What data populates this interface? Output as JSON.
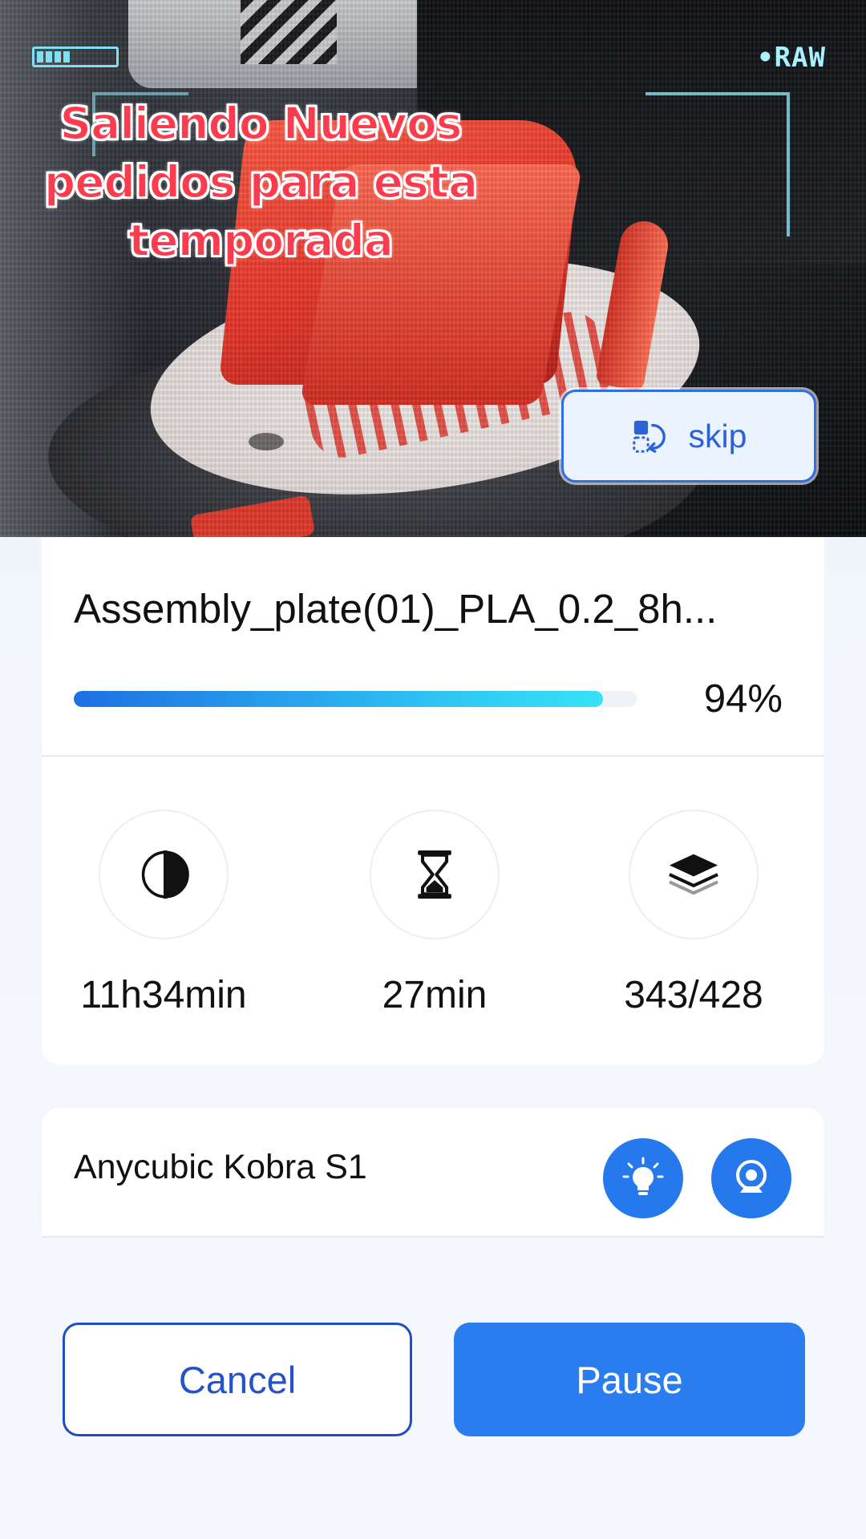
{
  "camera": {
    "hud_status": "•RAW",
    "battery_level": 0.45,
    "overlay_caption": [
      "Saliendo Nuevos",
      "pedidos para esta",
      "temporada"
    ],
    "skip_label": "skip"
  },
  "print_job": {
    "file_name": "Assembly_plate(01)_PLA_0.2_8h...",
    "progress_percent": 94,
    "progress_label": "94%",
    "stats": {
      "elapsed": {
        "icon": "half-circle-clock-icon",
        "value": "11h34min"
      },
      "remaining": {
        "icon": "hourglass-icon",
        "value": "27min"
      },
      "layers": {
        "icon": "layers-icon",
        "value": "343/428"
      }
    }
  },
  "printer": {
    "name": "Anycubic Kobra S1",
    "light_icon": "lightbulb-icon",
    "camera_icon": "webcam-icon"
  },
  "actions": {
    "cancel_label": "Cancel",
    "pause_label": "Pause"
  },
  "colors": {
    "accent": "#2b7def",
    "caption_red": "#fb3b4e",
    "hud_cyan": "#8be3f2"
  }
}
